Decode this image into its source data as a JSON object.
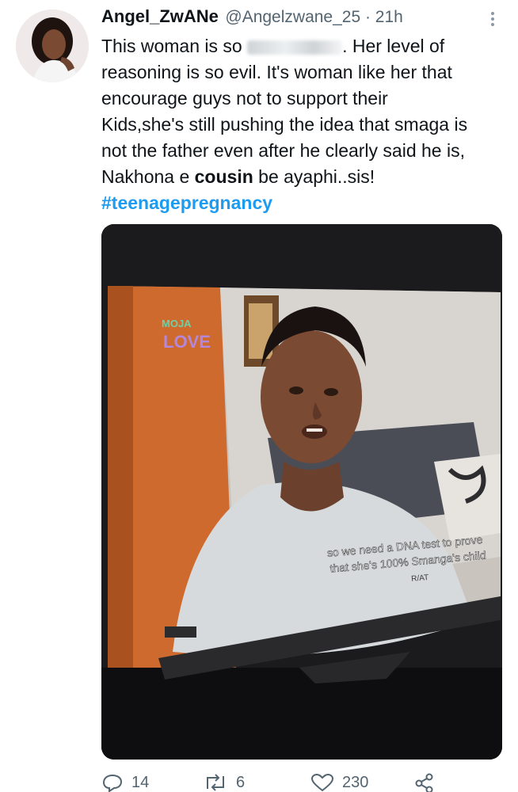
{
  "author": {
    "display_name": "Angel_ZwANe",
    "handle": "@Angelzwane_25 · 21h",
    "avatar_icon": "avatar-photo"
  },
  "tweet": {
    "line1_start": "This woman is so ",
    "line1_end": ". Her level of",
    "line2": "reasoning is so evil. It's woman like her that",
    "line3": "encourage guys not to support their",
    "line4": "Kids,she's still pushing the idea that smaga is",
    "line5": "not the father even after he clearly said he is,",
    "line6_start": "Nakhona e ",
    "line6_bold": "cousin",
    "line6_end": " be ayaphi..sis!",
    "hashtag": "#teenagepregnancy"
  },
  "media": {
    "logo_top": "MOJA",
    "logo_bottom": "LOVE",
    "subtitle_line1": "so we need a DNA test to prove",
    "subtitle_line2": "that she's 100% Smanga's child",
    "watermark": "R/AT"
  },
  "actions": {
    "replies": "14",
    "retweets": "6",
    "likes": "230"
  },
  "colors": {
    "accent": "#1d9bf0",
    "muted": "#536471"
  }
}
